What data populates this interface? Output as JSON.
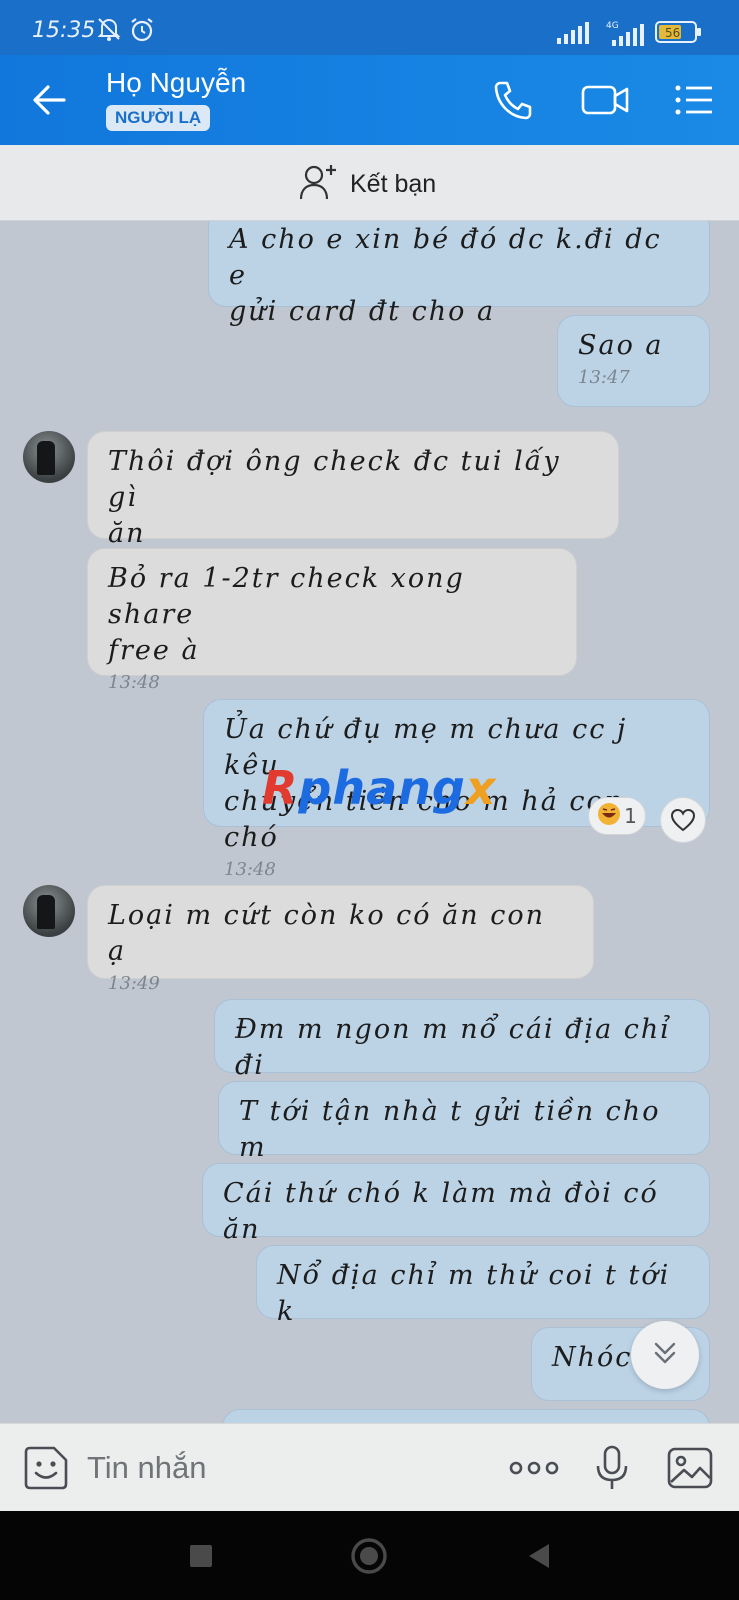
{
  "status_bar": {
    "time": "15:35",
    "network": "4G",
    "battery": "56"
  },
  "header": {
    "contact_name": "Họ Nguyễn",
    "badge": "NGƯỜI LẠ"
  },
  "add_friend": {
    "label": "Kết bạn"
  },
  "messages": {
    "m1_line1": "A cho e xin bé đó dc k.đi dc e",
    "m1_line2": "gửi card đt cho a",
    "m2_text": "Sao a",
    "m2_time": "13:47",
    "m3_line1": "Thôi đợi ông check đc tui lấy gì",
    "m3_line2": "ăn",
    "m4_line1": "Bỏ ra 1-2tr check xong share",
    "m4_line2": "free à",
    "m4_time": "13:48",
    "m5_line1": "Ủa chứ đụ mẹ m chưa cc j kêu",
    "m5_line2": "chuyển tiền cho m hả con chó",
    "m5_time": "13:48",
    "m5_reaction_count": "1",
    "m6_text": "Loại m cứt còn ko có ăn con ạ",
    "m6_time": "13:49",
    "m7_text": "Đm m ngon m nổ cái địa chỉ đi",
    "m8_text": "T tới tận nhà t gửi tiền cho m",
    "m9_text": "Cái thứ chó k làm mà đòi có ăn",
    "m10_text": "Nổ địa chỉ m thử coi t tới k",
    "m11_text": "Nhóc c"
  },
  "watermark": {
    "part1": "R",
    "part2": "phang",
    "part3": "x"
  },
  "input": {
    "placeholder": "Tin nhắn"
  },
  "colors": {
    "header": "#1177dc",
    "outgoing_bubble": "#bcd3e6",
    "incoming_bubble": "#dcdcdc",
    "chat_background": "#c0c7d1"
  }
}
